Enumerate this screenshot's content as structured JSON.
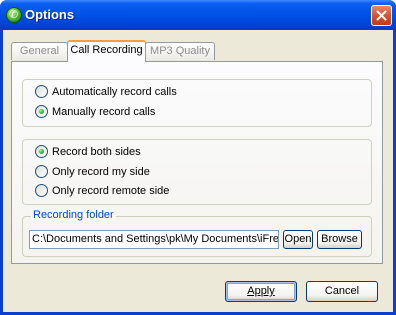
{
  "window": {
    "title": "Options",
    "close_glyph": "close-icon"
  },
  "tabs": [
    {
      "label": "General",
      "active": false
    },
    {
      "label": "Call Recording",
      "active": true
    },
    {
      "label": "MP3 Quality",
      "active": false
    }
  ],
  "record_mode": [
    {
      "label": "Automatically record calls",
      "checked": false
    },
    {
      "label": "Manually record calls",
      "checked": true
    }
  ],
  "record_sides": [
    {
      "label": "Record both sides",
      "checked": true
    },
    {
      "label": "Only record my side",
      "checked": false
    },
    {
      "label": "Only record remote side",
      "checked": false
    }
  ],
  "recording_folder": {
    "title": "Recording folder",
    "path": "C:\\Documents and Settings\\pk\\My Documents\\iFree Skype Recorder",
    "open_label": "Open",
    "browse_label": "Browse"
  },
  "buttons": {
    "apply_label": "Apply",
    "cancel_label": "Cancel"
  },
  "colors": {
    "title_bar": "#0050e6",
    "dialog_bg": "#ece9d8",
    "active_tab_accent": "#ff9c3a",
    "group_title": "#0046d5"
  }
}
